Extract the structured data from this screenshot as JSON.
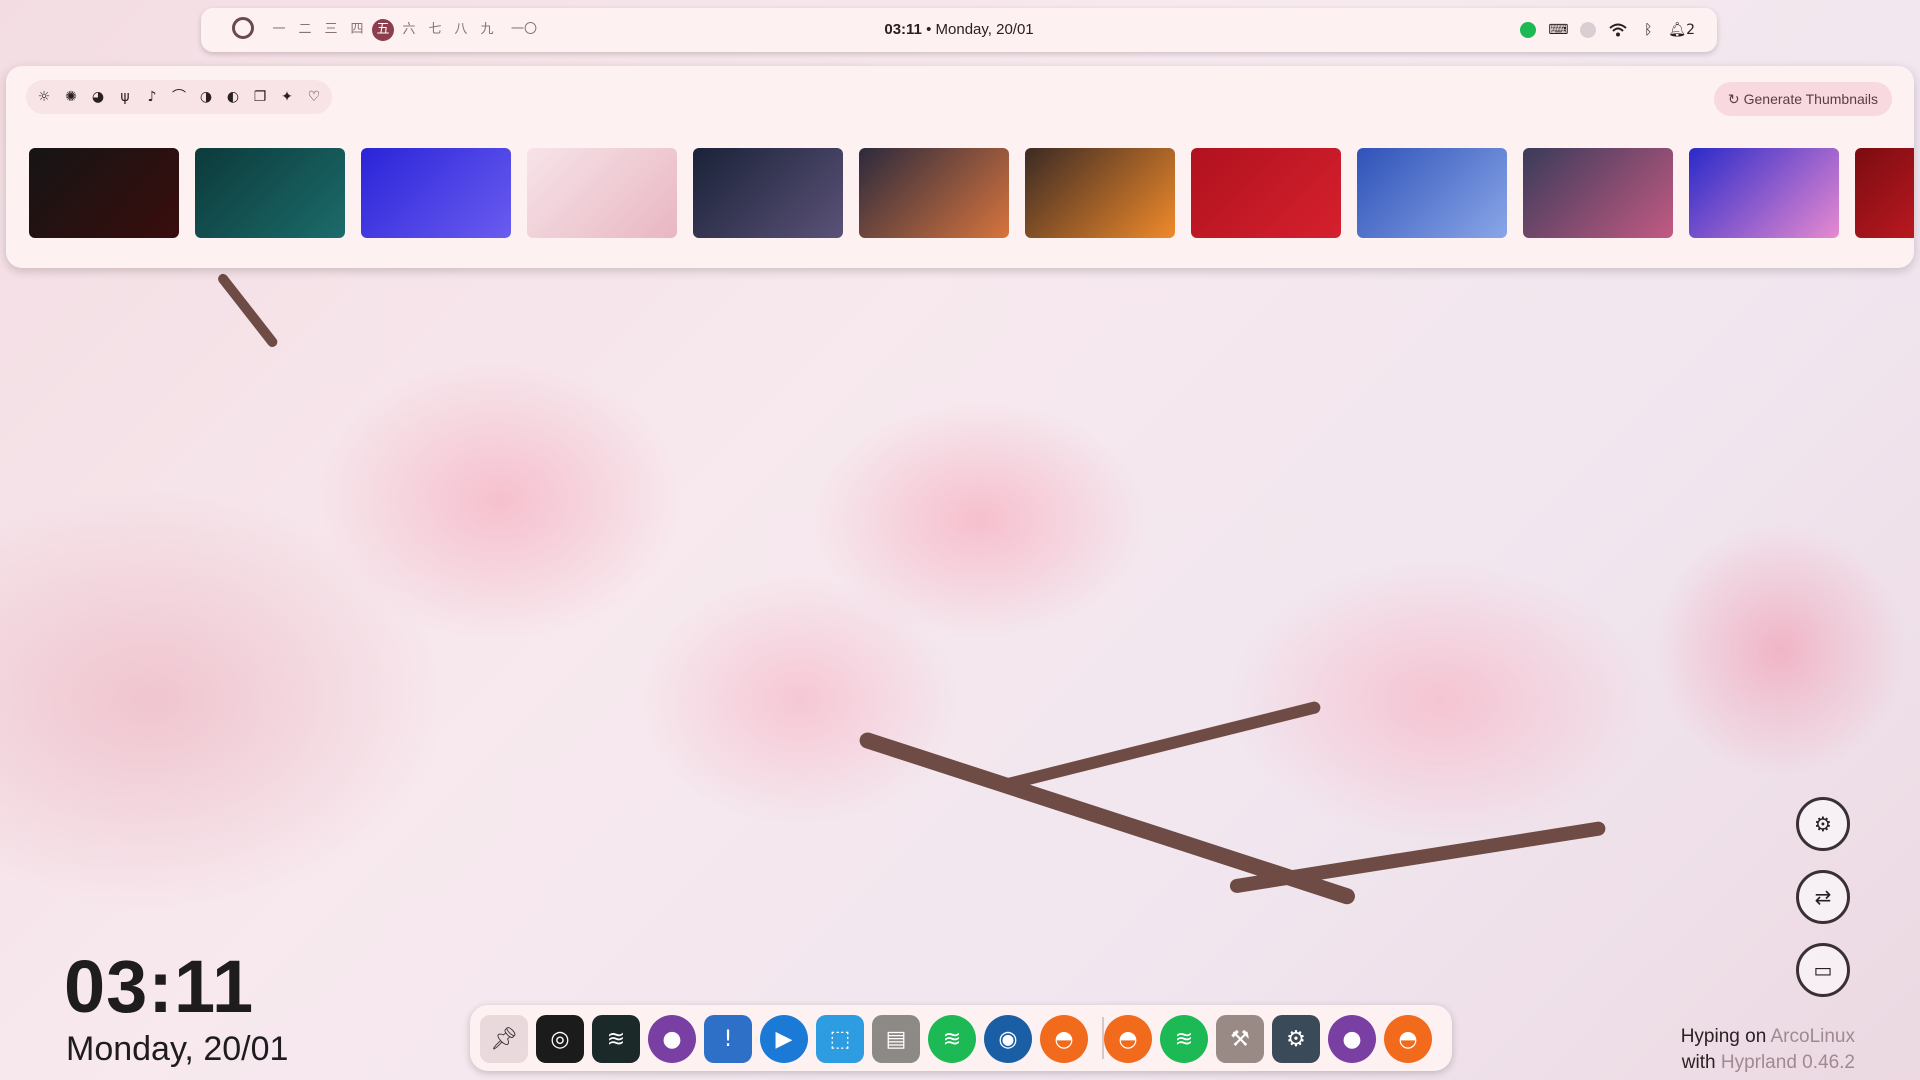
{
  "topbar": {
    "workspaces": [
      "一",
      "二",
      "三",
      "四",
      "五",
      "六",
      "七",
      "八",
      "九",
      "一〇"
    ],
    "active_workspace": "五",
    "time": "03:11",
    "separator": "•",
    "date": "Monday, 20/01",
    "tray": [
      "spotify-icon",
      "keyboard-icon",
      "app-icon",
      "wifi-icon",
      "bluetooth-icon",
      "bell-icon"
    ],
    "notification_count": "2"
  },
  "wallpaper_panel": {
    "filters": [
      "sun-icon",
      "sparkle-icon",
      "palette-icon",
      "food-icon",
      "music-icon",
      "rainbow-icon",
      "contrast-icon",
      "half-circle-icon",
      "chat-icon",
      "stars-icon",
      "heart-icon"
    ],
    "generate_button": "Generate Thumbnails",
    "thumbnails": [
      {
        "name": "venom",
        "colors": [
          "#151515",
          "#3a0d0d"
        ]
      },
      {
        "name": "venom-teal",
        "colors": [
          "#0c3a3a",
          "#1c6b6b"
        ]
      },
      {
        "name": "astronaut",
        "colors": [
          "#2a24d8",
          "#6a5cf0"
        ]
      },
      {
        "name": "cherry-blossom",
        "colors": [
          "#f6e4e8",
          "#e9b6c3"
        ]
      },
      {
        "name": "night-lake",
        "colors": [
          "#1a2238",
          "#5b5278"
        ]
      },
      {
        "name": "sunset-girl",
        "colors": [
          "#2c2a3d",
          "#d7743d"
        ]
      },
      {
        "name": "sunset-window",
        "colors": [
          "#3b2a24",
          "#f08a2a"
        ]
      },
      {
        "name": "red-gundam",
        "colors": [
          "#b0121e",
          "#d6202e"
        ]
      },
      {
        "name": "blue-sky",
        "colors": [
          "#2f52b8",
          "#8aa6e8"
        ]
      },
      {
        "name": "pink-rails",
        "colors": [
          "#3a3b5a",
          "#c25a82"
        ]
      },
      {
        "name": "purple-wave",
        "colors": [
          "#2a2ac9",
          "#e78ad0"
        ]
      },
      {
        "name": "red-lightning",
        "colors": [
          "#7a0c10",
          "#e0202a"
        ]
      }
    ]
  },
  "desktop": {
    "clock": "03:11",
    "date": "Monday, 20/01",
    "hyping_prefix": "Hyping on",
    "hyping_distro": "ArcoLinux",
    "with_prefix": "with",
    "with_wm": "Hyprland 0.46.2"
  },
  "side_buttons": [
    "cpu-icon",
    "swap-icon",
    "panel-icon"
  ],
  "dock": {
    "apps": [
      {
        "name": "pin",
        "color": "#e9d9dc"
      },
      {
        "name": "target-app",
        "color": "#1b1b1b"
      },
      {
        "name": "fin-app",
        "color": "#1b2a28"
      },
      {
        "name": "github",
        "color": "#7a3fa3"
      },
      {
        "name": "shield-app",
        "color": "#2e6fc8"
      },
      {
        "name": "player-app",
        "color": "#1a7ad6"
      },
      {
        "name": "screenshot-app",
        "color": "#2e9ce0"
      },
      {
        "name": "files-app",
        "color": "#8d8a86"
      },
      {
        "name": "spotify",
        "color": "#1db954"
      },
      {
        "name": "steam",
        "color": "#1a5fa6"
      },
      {
        "name": "firefox",
        "color": "#f26a1b"
      },
      {
        "name": "firefox",
        "color": "#f26a1b"
      },
      {
        "name": "spotify",
        "color": "#1db954"
      },
      {
        "name": "hammer-app",
        "color": "#9a8a86"
      },
      {
        "name": "settings",
        "color": "#3b4a58"
      },
      {
        "name": "github",
        "color": "#7a3fa3"
      },
      {
        "name": "firefox",
        "color": "#f26a1b"
      }
    ]
  }
}
